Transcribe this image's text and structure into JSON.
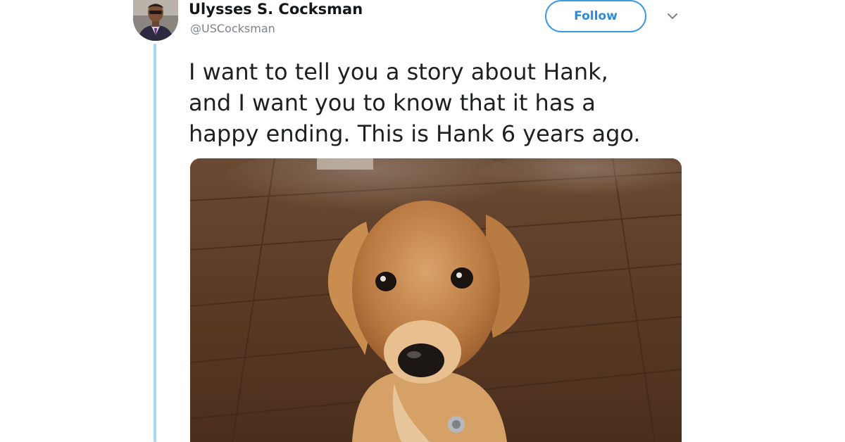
{
  "tweet": {
    "author_name": "Ulysses S. Cocksman",
    "author_handle": "@USCocksman",
    "follow_label": "Follow",
    "text_lines": [
      "I want to tell you a story about Hank,",
      "and I want you to know that it has a",
      "happy ending. This is Hank 6 years ago."
    ],
    "media_icon": "photo-of-puppy",
    "avatar_icon": "user-avatar"
  },
  "colors": {
    "accent": "#1da1f2",
    "thread_line": "#a7d8f5",
    "handle_text": "#7a848c"
  }
}
